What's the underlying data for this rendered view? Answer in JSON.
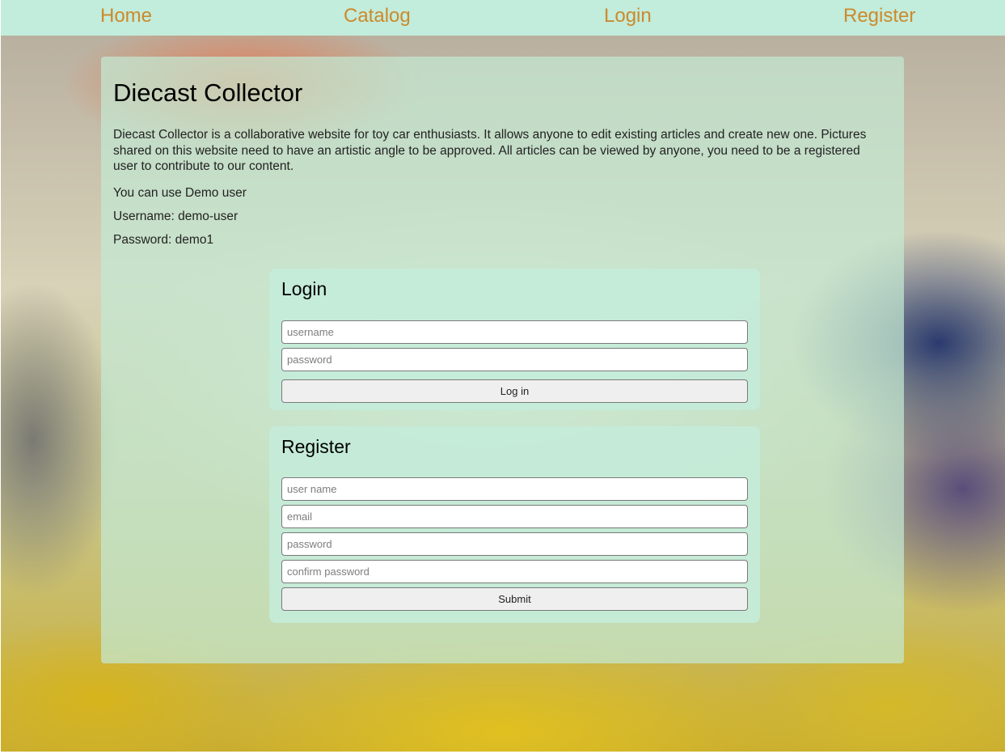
{
  "nav": {
    "home": "Home",
    "catalog": "Catalog",
    "login": "Login",
    "register": "Register",
    "link_color": "#cc8a2b",
    "bar_color": "#c2ecdb"
  },
  "main": {
    "title": "Diecast Collector",
    "description": "Diecast Collector is a collaborative website for toy car enthusiasts. It allows anyone to edit existing articles and create new one. Pictures shared on this website need to have an artistic angle to be approved. All articles can be viewed by anyone, you need to be a registered user to contribute to our content.",
    "demo_note": "You can use Demo user",
    "demo_username": "Username: demo-user",
    "demo_password": "Password: demo1"
  },
  "login_form": {
    "title": "Login",
    "username_placeholder": "username",
    "password_placeholder": "password",
    "submit_label": "Log in"
  },
  "register_form": {
    "title": "Register",
    "username_placeholder": "user name",
    "email_placeholder": "email",
    "password_placeholder": "password",
    "confirm_placeholder": "confirm password",
    "submit_label": "Submit"
  }
}
